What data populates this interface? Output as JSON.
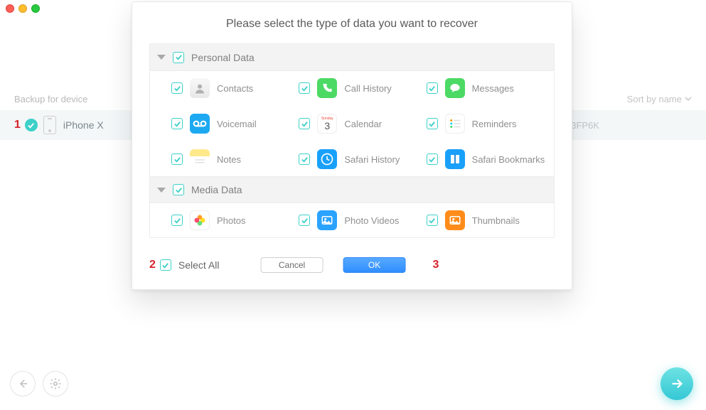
{
  "window": {
    "backup_label": "Backup for device",
    "sort_label": "Sort by name",
    "device_name": "iPhone X",
    "serial_tail": "3FP6K"
  },
  "modal": {
    "title": "Please select the type of data you want to recover",
    "sections": {
      "personal": {
        "label": "Personal Data"
      },
      "media": {
        "label": "Media Data"
      }
    },
    "items": {
      "contacts": "Contacts",
      "call_history": "Call History",
      "messages": "Messages",
      "voicemail": "Voicemail",
      "calendar": "Calendar",
      "reminders": "Reminders",
      "notes": "Notes",
      "safari_history": "Safari History",
      "safari_bookmarks": "Safari Bookmarks",
      "photos": "Photos",
      "photo_videos": "Photo Videos",
      "thumbnails": "Thumbnails"
    },
    "calendar_top": "Sunday",
    "calendar_day": "3",
    "select_all": "Select All",
    "cancel": "Cancel",
    "ok": "OK"
  },
  "annotations": {
    "a1": "1",
    "a2": "2",
    "a3": "3"
  }
}
